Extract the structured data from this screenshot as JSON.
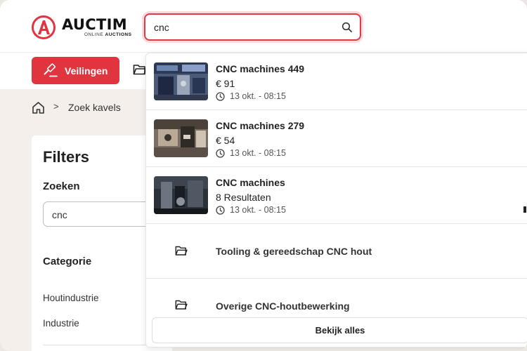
{
  "brand": {
    "name": "AUCTIM",
    "tagline_part1": "ONLINE",
    "tagline_part2": "AUCTIONS",
    "accent": "#e0343f"
  },
  "search": {
    "value": "cnc",
    "icon": "search-icon"
  },
  "nav": {
    "auctions_label": "Veilingen",
    "auctions_icon": "gavel-icon",
    "folder_icon": "folder-icon"
  },
  "breadcrumb": {
    "icon": "home-icon",
    "separator": ">",
    "current": "Zoek kavels"
  },
  "filters": {
    "title": "Filters",
    "search_heading": "Zoeken",
    "search_value": "cnc",
    "category_heading": "Categorie",
    "categories": [
      "Houtindustrie",
      "Industrie"
    ]
  },
  "dropdown": {
    "results": [
      {
        "title": "CNC machines 449",
        "sub": "€ 91",
        "time": "13 okt. - 08:15"
      },
      {
        "title": "CNC machines 279",
        "sub": "€ 54",
        "time": "13 okt. - 08:15"
      },
      {
        "title": "CNC machines",
        "sub": "8 Resultaten",
        "time": "13 okt. - 08:15"
      }
    ],
    "categories": [
      {
        "label": "Tooling & gereedschap CNC hout",
        "icon": "folder-icon"
      },
      {
        "label": "Overige CNC-houtbewerking",
        "icon": "folder-icon"
      }
    ],
    "view_all": "Bekijk alles"
  }
}
